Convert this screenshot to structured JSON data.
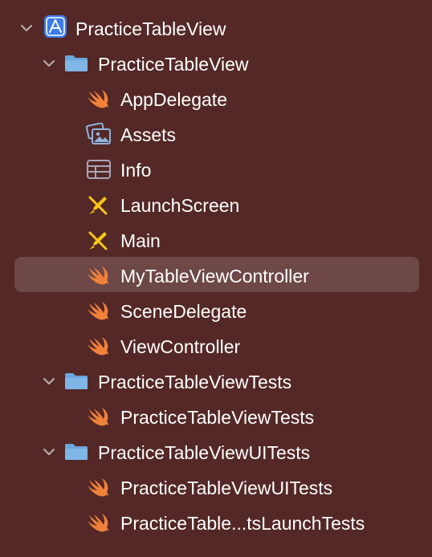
{
  "tree": {
    "project": {
      "label": "PracticeTableView",
      "icon": "xcode-project-icon",
      "expanded": true
    },
    "groups": [
      {
        "label": "PracticeTableView",
        "icon": "folder-icon",
        "expanded": true,
        "files": [
          {
            "label": "AppDelegate",
            "icon": "swift-icon"
          },
          {
            "label": "Assets",
            "icon": "asset-catalog-icon"
          },
          {
            "label": "Info",
            "icon": "plist-icon"
          },
          {
            "label": "LaunchScreen",
            "icon": "storyboard-icon"
          },
          {
            "label": "Main",
            "icon": "storyboard-icon"
          },
          {
            "label": "MyTableViewController",
            "icon": "swift-icon",
            "selected": true
          },
          {
            "label": "SceneDelegate",
            "icon": "swift-icon"
          },
          {
            "label": "ViewController",
            "icon": "swift-icon"
          }
        ]
      },
      {
        "label": "PracticeTableViewTests",
        "icon": "folder-icon",
        "expanded": true,
        "files": [
          {
            "label": "PracticeTableViewTests",
            "icon": "swift-icon"
          }
        ]
      },
      {
        "label": "PracticeTableViewUITests",
        "icon": "folder-icon",
        "expanded": true,
        "files": [
          {
            "label": "PracticeTableViewUITests",
            "icon": "swift-icon"
          },
          {
            "label": "PracticeTable...tsLaunchTests",
            "icon": "swift-icon"
          }
        ]
      }
    ]
  },
  "colors": {
    "background": "#542826",
    "selection": "#6e4846",
    "swift": "#f0813a",
    "folder": "#6aa6dc",
    "storyboard": "#f5c518",
    "asset": "#8fb4dc",
    "plist": "#a9a4b8",
    "disclosure": "#b9a8a6"
  }
}
